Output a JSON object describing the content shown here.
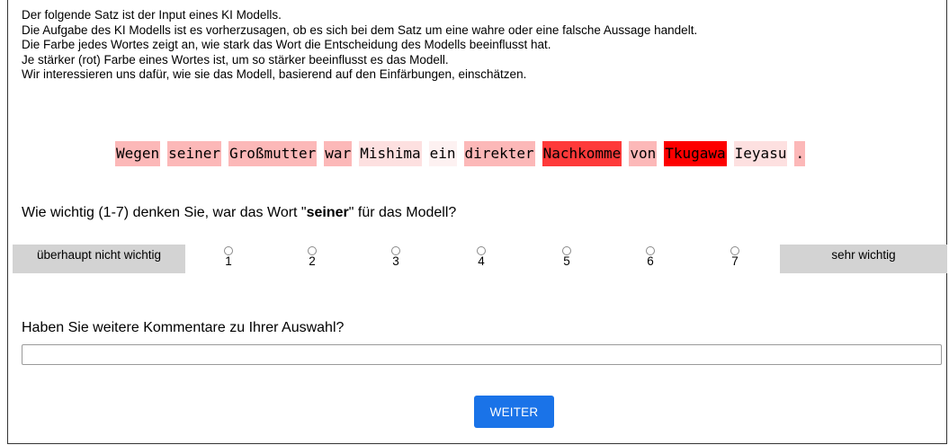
{
  "instructions": [
    "Der folgende Satz ist der Input eines KI Modells.",
    "Die Aufgabe des KI Modells ist es vorherzusagen, ob es sich bei dem Satz um eine wahre oder eine falsche Aussage handelt.",
    "Die Farbe jedes Wortes zeigt an, wie stark das Wort die Entscheidung des Modells beeinflusst hat.",
    "Je stärker (rot) Farbe eines Wortes ist, um so stärker beeinflusst es das Modell.",
    "Wir interessieren uns dafür, wie sie das Modell, basierend auf den Einfärbungen, einschätzen."
  ],
  "sentence": {
    "words": [
      {
        "text": "Wegen",
        "color": "#fcb8b8"
      },
      {
        "text": "seiner",
        "color": "#fcb8b8"
      },
      {
        "text": "Großmutter",
        "color": "#fcb8b8"
      },
      {
        "text": "war",
        "color": "#fcb8b8"
      },
      {
        "text": "Mishima",
        "color": "#fde0e0"
      },
      {
        "text": "ein",
        "color": "#fdf1f1"
      },
      {
        "text": "direkter",
        "color": "#fcb8b8"
      },
      {
        "text": "Nachkomme",
        "color": "#fe3a3a"
      },
      {
        "text": "von",
        "color": "#fcb8b8"
      },
      {
        "text": "Tkugawa",
        "color": "#fd0000"
      },
      {
        "text": "Ieyasu",
        "color": "#fde0e0"
      },
      {
        "text": ".",
        "color": "#fcb8b8"
      }
    ]
  },
  "question": {
    "prefix": "Wie wichtig (1-7) denken Sie, war das Wort \"",
    "word": "seiner",
    "suffix": "\" für das Modell?"
  },
  "scale": {
    "low_label": "überhaupt nicht wichtig",
    "high_label": "sehr wichtig",
    "options": [
      "1",
      "2",
      "3",
      "4",
      "5",
      "6",
      "7"
    ],
    "selected": null
  },
  "comment": {
    "question": "Haben Sie weitere Kommentare zu Ihrer Auswahl?",
    "value": "",
    "placeholder": ""
  },
  "next_button": {
    "label": "WEITER",
    "color": "#1a73e8"
  }
}
